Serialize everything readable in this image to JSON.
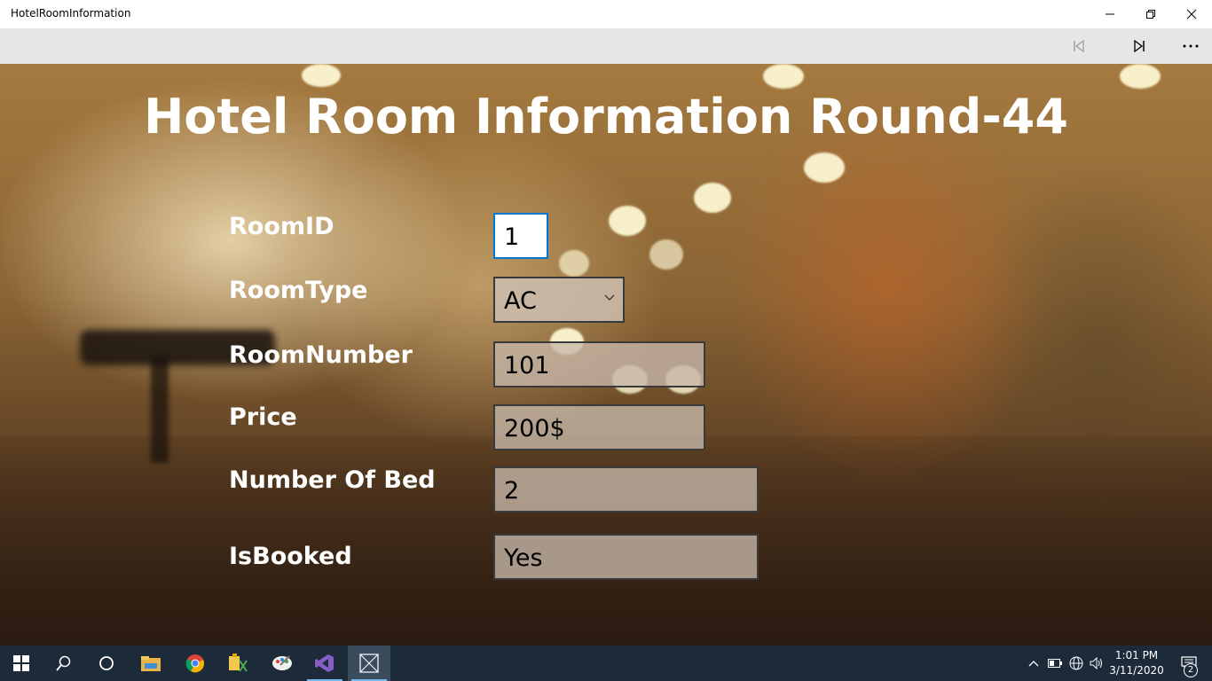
{
  "window": {
    "title": "HotelRoomInformation"
  },
  "page": {
    "heading": "Hotel Room Information Round-44"
  },
  "form": {
    "room_id": {
      "label": "RoomID",
      "value": "1"
    },
    "room_type": {
      "label": "RoomType",
      "value": "AC"
    },
    "room_number": {
      "label": "RoomNumber",
      "value": "101"
    },
    "price": {
      "label": "Price",
      "value": "200$"
    },
    "number_of_bed": {
      "label": "Number Of Bed",
      "value": "2"
    },
    "is_booked": {
      "label": "IsBooked",
      "value": "Yes"
    }
  },
  "taskbar": {
    "pinned_icons": [
      "windows-start-icon",
      "search-icon",
      "cortana-icon",
      "file-explorer-icon",
      "chrome-icon",
      "app-icon",
      "paint-icon",
      "visual-studio-icon",
      "hotel-app-icon"
    ],
    "clock_time": "1:01 PM",
    "clock_date": "3/11/2020",
    "notification_count": "2"
  },
  "colors": {
    "titlebar": "#ffffff",
    "commandbar": "#e6e6e6",
    "taskbar": "#1c2a3a",
    "focus_border": "#0078d7"
  }
}
